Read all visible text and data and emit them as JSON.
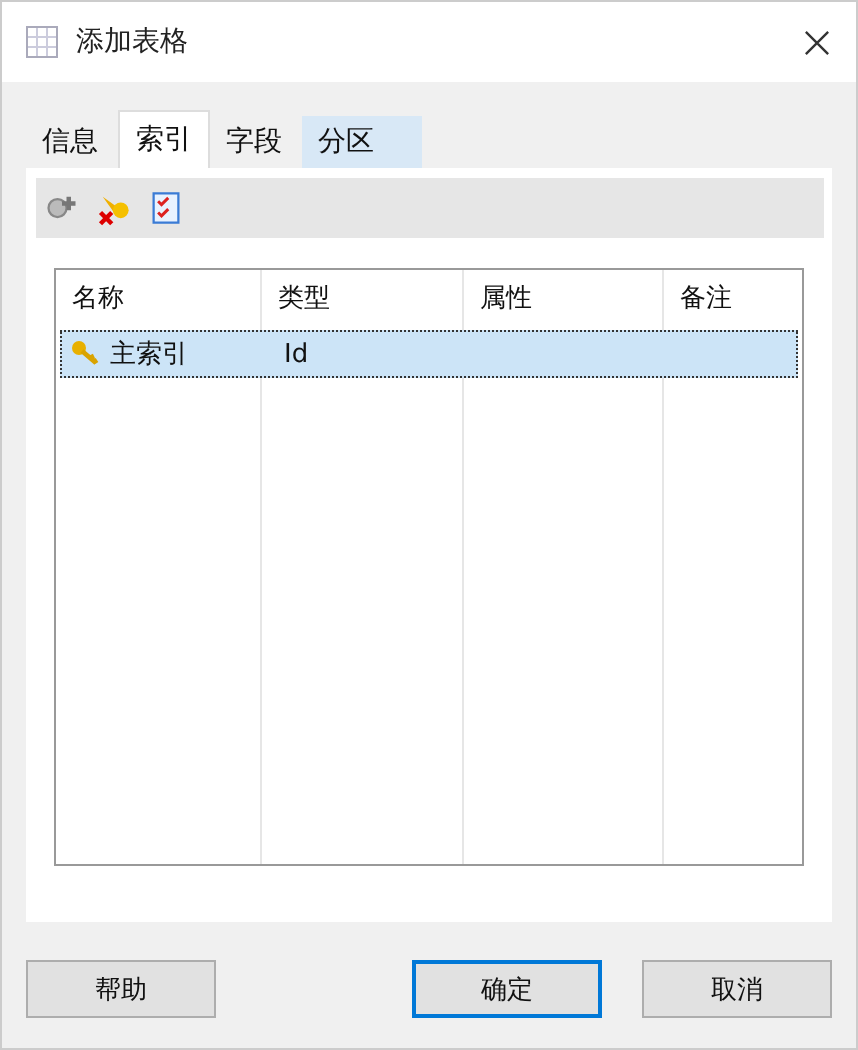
{
  "window": {
    "title": "添加表格"
  },
  "tabs": [
    {
      "label": "信息",
      "selected": false,
      "hovered": false
    },
    {
      "label": "索引",
      "selected": true,
      "hovered": false
    },
    {
      "label": "字段",
      "selected": false,
      "hovered": false
    },
    {
      "label": "分区",
      "selected": false,
      "hovered": true
    }
  ],
  "toolbar": [
    {
      "kind": "add"
    },
    {
      "kind": "delete"
    },
    {
      "kind": "check"
    }
  ],
  "table": {
    "columns": [
      "名称",
      "类型",
      "属性",
      "备注"
    ],
    "rows": [
      {
        "selected": true,
        "kind": "key",
        "cells": [
          "主索引",
          "Id",
          "",
          ""
        ]
      }
    ]
  },
  "buttons": [
    {
      "label": "帮助",
      "default": false
    },
    {
      "label": "确定",
      "default": true
    },
    {
      "label": "取消",
      "default": false
    }
  ]
}
